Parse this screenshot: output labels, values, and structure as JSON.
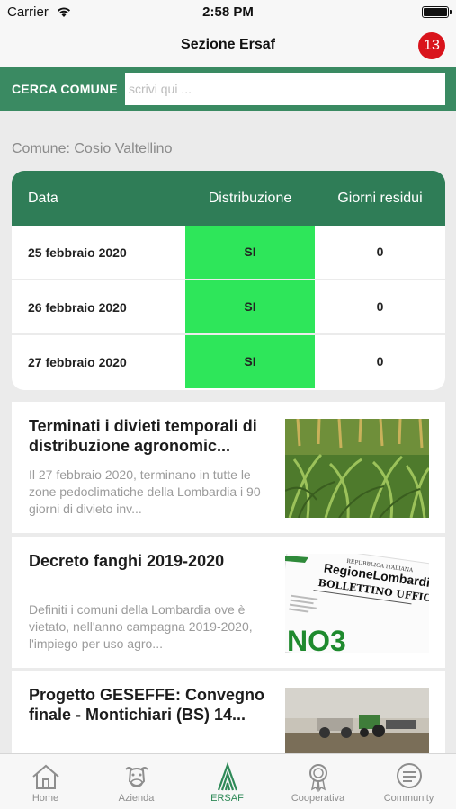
{
  "status_bar": {
    "carrier": "Carrier",
    "time": "2:58 PM"
  },
  "nav": {
    "title": "Sezione Ersaf",
    "badge_count": "13"
  },
  "search": {
    "label": "CERCA COMUNE",
    "placeholder": "scrivi qui ...",
    "value": ""
  },
  "comune": {
    "label": "Comune: Cosio Valtellino"
  },
  "table": {
    "headers": {
      "date": "Data",
      "distribution": "Distribuzione",
      "days_left": "Giorni residui"
    },
    "rows": [
      {
        "date": "25 febbraio 2020",
        "distribution": "SI",
        "days_left": "0"
      },
      {
        "date": "26 febbraio 2020",
        "distribution": "SI",
        "days_left": "0"
      },
      {
        "date": "27 febbraio 2020",
        "distribution": "SI",
        "days_left": "0"
      }
    ]
  },
  "news": [
    {
      "title": "Terminati i divieti temporali di distribuzione agronomic...",
      "body": "Il 27 febbraio 2020, terminano in tutte le zone pedoclimatiche della Lombardia i 90 giorni di divieto inv...",
      "image": "cornfield-photo"
    },
    {
      "title": "Decreto fanghi 2019-2020",
      "body": "Definiti i comuni della Lombardia ove è vietato, nell'anno campagna 2019-2020, l'impiego per uso agro...",
      "image": "bollettino-ufficiale-photo",
      "image_text": {
        "line1": "REPUBBLICA ITALIANA",
        "line2": "RegioneLombardia",
        "line3": "BOLLETTINO UFFICIALE",
        "line4": "NO3"
      }
    },
    {
      "title": "Progetto GESEFFE: Convegno finale - Montichiari (BS) 14...",
      "body": "",
      "image": "tractor-field-photo"
    }
  ],
  "tab_bar": {
    "active": "ERSAF",
    "accent_color": "#2f8a58",
    "items": [
      {
        "label": "Home",
        "icon": "home-icon"
      },
      {
        "label": "Azienda",
        "icon": "cow-icon"
      },
      {
        "label": "ERSAF",
        "icon": "ersaf-logo-icon"
      },
      {
        "label": "Cooperativa",
        "icon": "award-icon"
      },
      {
        "label": "Community",
        "icon": "chat-icon"
      }
    ]
  },
  "colors": {
    "primary_green": "#3a8a62",
    "header_green": "#2f7d57",
    "yes_green": "#2ee65a",
    "badge_red": "#d9141c"
  }
}
